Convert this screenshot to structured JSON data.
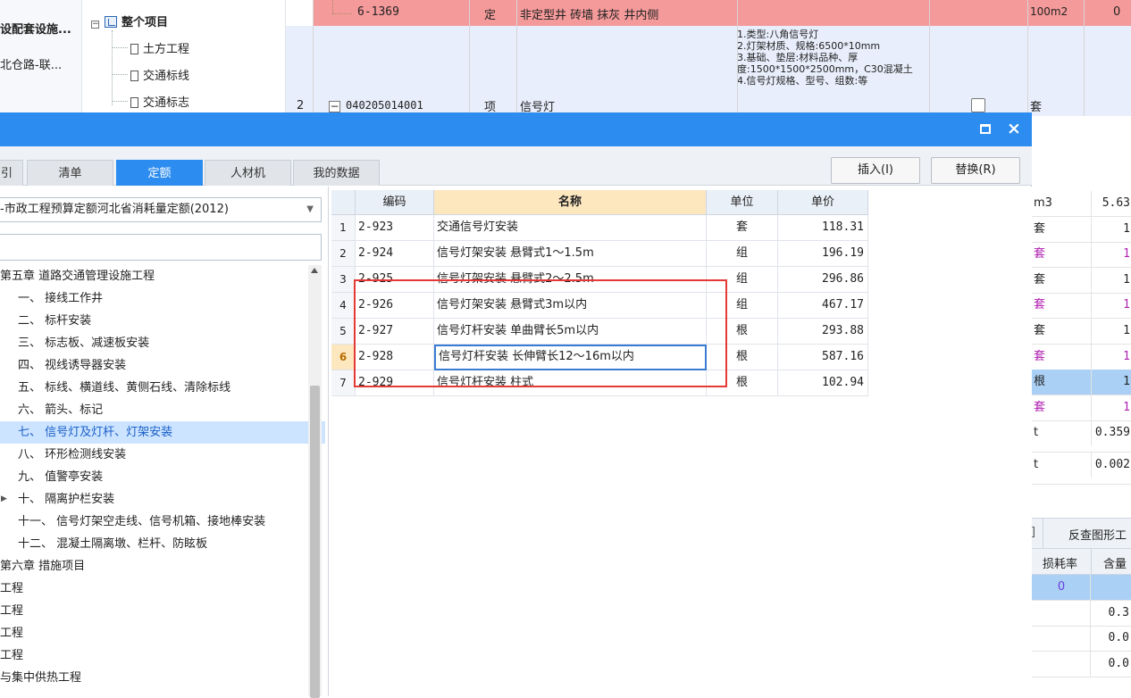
{
  "bg": {
    "left_items": [
      "设配套设施...",
      "北仓路-联..."
    ],
    "tree_root": "整个项目",
    "tree_children": [
      "土方工程",
      "交通标线",
      "交通标志"
    ],
    "row1": {
      "code": "6-1369",
      "type": "定",
      "name": "非定型井 砖墙 抹灰 井内侧",
      "unit": "100m2",
      "qty": "0"
    },
    "row2": {
      "num": "2",
      "code": "040205014001",
      "type": "项",
      "name": "信号灯",
      "desc": "1.类型:八角信号灯\n2.灯架材质、规格:6500*10mm\n3.基础、垫层:材料品种、厚度:1500*1500*2500mm，C30混凝土\n4.信号灯规格、型号、组数:等",
      "unit": "套"
    },
    "right_rows": [
      {
        "u": "m3",
        "v": "5.63",
        "purple": false,
        "sel": false
      },
      {
        "u": "套",
        "v": "1",
        "purple": false,
        "sel": false
      },
      {
        "u": "套",
        "v": "1",
        "purple": true,
        "sel": false
      },
      {
        "u": "套",
        "v": "1",
        "purple": false,
        "sel": false
      },
      {
        "u": "套",
        "v": "1",
        "purple": true,
        "sel": false
      },
      {
        "u": "套",
        "v": "1",
        "purple": false,
        "sel": false
      },
      {
        "u": "套",
        "v": "1",
        "purple": true,
        "sel": false
      },
      {
        "u": "根",
        "v": "1",
        "purple": false,
        "sel": true
      },
      {
        "u": "套",
        "v": "1",
        "purple": true,
        "sel": false
      },
      {
        "u": "t",
        "v": "0.359",
        "purple": false,
        "sel": false
      },
      {
        "u": "t",
        "v": "0.002",
        "purple": false,
        "sel": false
      }
    ],
    "bottom_tabs": [
      "]",
      "反查图形工"
    ],
    "bottom_headers": [
      "损耗率",
      "含量"
    ],
    "bottom_rows": [
      {
        "a": "0",
        "b": ""
      },
      {
        "a": "",
        "b": "0.3"
      },
      {
        "a": "",
        "b": "0.0"
      },
      {
        "a": "",
        "b": "0.0"
      }
    ]
  },
  "dialog": {
    "tabs": [
      "引",
      "清单",
      "定额",
      "人材机",
      "我的数据"
    ],
    "active_tab": "定额",
    "insert_label": "插入(I)",
    "replace_label": "替换(R)",
    "library": "-市政工程预算定额河北省消耗量定额(2012)",
    "search_placeholder": "",
    "tree": [
      {
        "label": "第五章 道路交通管理设施工程",
        "indent": 0,
        "sel": false
      },
      {
        "label": "一、 接线工作井",
        "indent": 1,
        "sel": false
      },
      {
        "label": "二、 标杆安装",
        "indent": 1,
        "sel": false
      },
      {
        "label": "三、 标志板、减速板安装",
        "indent": 1,
        "sel": false
      },
      {
        "label": "四、 视线诱导器安装",
        "indent": 1,
        "sel": false
      },
      {
        "label": "五、 标线、横道线、黄侧石线、清除标线",
        "indent": 1,
        "sel": false
      },
      {
        "label": "六、 箭头、标记",
        "indent": 1,
        "sel": false
      },
      {
        "label": "七、 信号灯及灯杆、灯架安装",
        "indent": 1,
        "sel": true
      },
      {
        "label": "八、 环形检测线安装",
        "indent": 1,
        "sel": false
      },
      {
        "label": "九、 值警亭安装",
        "indent": 1,
        "sel": false
      },
      {
        "label": "十、 隔离护栏安装",
        "indent": 1,
        "sel": false,
        "arrow": true
      },
      {
        "label": "十一、 信号灯架空走线、信号机箱、接地棒安装",
        "indent": 1,
        "sel": false
      },
      {
        "label": "十二、 混凝土隔离墩、栏杆、防眩板",
        "indent": 1,
        "sel": false
      },
      {
        "label": "第六章 措施项目",
        "indent": 0,
        "sel": false
      },
      {
        "label": "工程",
        "indent": 0,
        "sel": false
      },
      {
        "label": "工程",
        "indent": 0,
        "sel": false
      },
      {
        "label": "工程",
        "indent": 0,
        "sel": false
      },
      {
        "label": "工程",
        "indent": 0,
        "sel": false
      },
      {
        "label": "与集中供热工程",
        "indent": 0,
        "sel": false
      }
    ],
    "grid_headers": {
      "code": "编码",
      "name": "名称",
      "unit": "单位",
      "price": "单价"
    },
    "grid_rows": [
      {
        "idx": "1",
        "code": "2-923",
        "name": "交通信号灯安装",
        "unit": "套",
        "price": "118.31"
      },
      {
        "idx": "2",
        "code": "2-924",
        "name": "信号灯架安装 悬臂式1～1.5m",
        "unit": "组",
        "price": "196.19"
      },
      {
        "idx": "3",
        "code": "2-925",
        "name": "信号灯架安装 悬臂式2～2.5m",
        "unit": "组",
        "price": "296.86"
      },
      {
        "idx": "4",
        "code": "2-926",
        "name": "信号灯架安装 悬臂式3m以内",
        "unit": "组",
        "price": "467.17"
      },
      {
        "idx": "5",
        "code": "2-927",
        "name": "信号灯杆安装 单曲臂长5m以内",
        "unit": "根",
        "price": "293.88"
      },
      {
        "idx": "6",
        "code": "2-928",
        "name": "信号灯杆安装 长伸臂长12～16m以内",
        "unit": "根",
        "price": "587.16"
      },
      {
        "idx": "7",
        "code": "2-929",
        "name": "信号灯杆安装 柱式",
        "unit": "根",
        "price": "102.94"
      }
    ],
    "current_row": 6
  }
}
